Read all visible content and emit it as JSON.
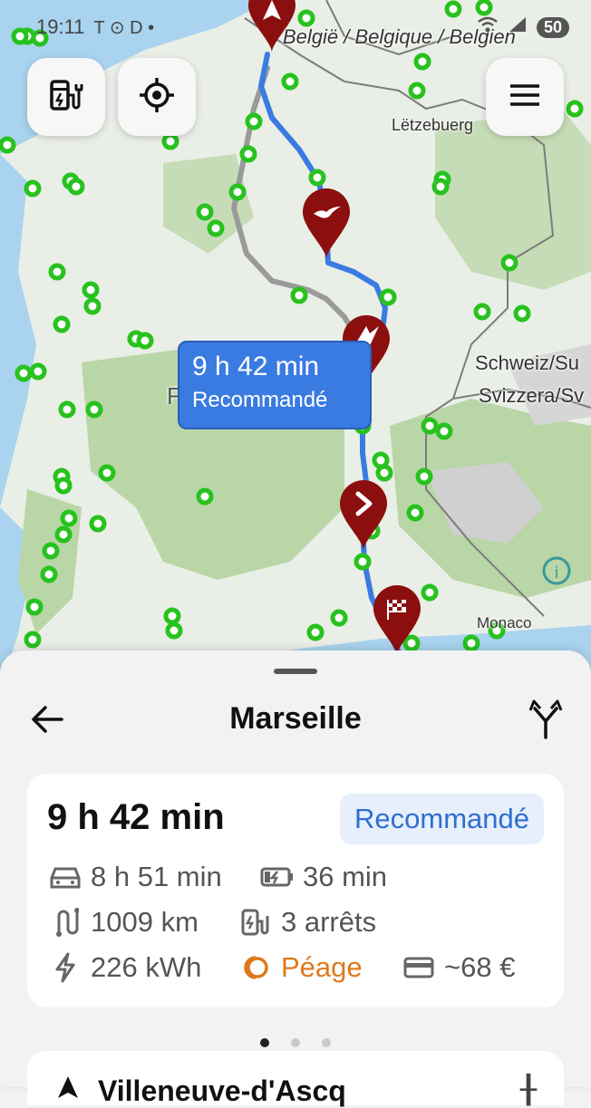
{
  "status_bar": {
    "time": "19:11",
    "icons_left": "T ⊙ D •",
    "battery": "50"
  },
  "map": {
    "labels": {
      "belgium": "België / Belgique / Belgien",
      "luxembourg": "Lëtzebuerg",
      "switzerland_1": "Schweiz/Su",
      "switzerland_2": "Svizzera/Sv",
      "monaco": "Monaco",
      "france_partial": "F"
    },
    "route_callout": {
      "duration": "9 h 42 min",
      "tag": "Recommandé"
    },
    "buttons": {
      "charger": "charger-filter-icon",
      "locate": "locate-icon",
      "menu": "menu-icon"
    },
    "colors": {
      "route": "#3a7be2",
      "alt_route": "#9a9a9a",
      "charger_dot": "#27c21e",
      "stop_pin": "#8b0f0f"
    }
  },
  "sheet": {
    "destination": "Marseille",
    "summary": {
      "duration": "9 h 42 min",
      "badge": "Recommandé",
      "drive_time": "8 h 51 min",
      "charge_time": "36 min",
      "distance": "1009 km",
      "stops": "3 arrêts",
      "energy": "226 kWh",
      "toll": "Péage",
      "cost": "~68 €"
    },
    "next_card_text": "Villeneuve-d'Ascq"
  }
}
